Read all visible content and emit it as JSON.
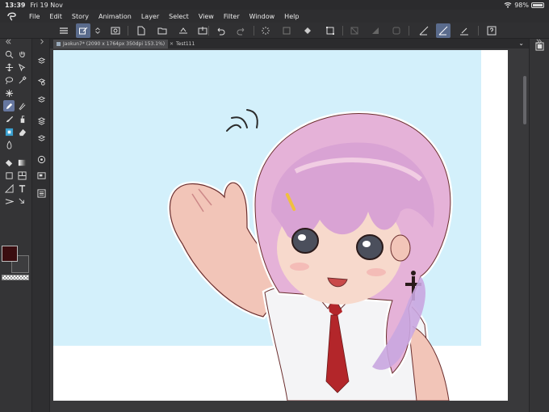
{
  "status": {
    "time": "13:39",
    "date": "Fri 19 Nov",
    "battery": "98%",
    "battery_level": 0.98
  },
  "menu": {
    "items": [
      "File",
      "Edit",
      "Story",
      "Animation",
      "Layer",
      "Select",
      "View",
      "Filter",
      "Window",
      "Help"
    ]
  },
  "tabs": [
    {
      "label": "Jaokun7* (2090 x 1764px 350dpi 153.1%)"
    },
    {
      "label": "Test111"
    }
  ],
  "colors": {
    "main_color": "#3a0d10",
    "accent": "#5a6b8c",
    "canvas_sky": "#d3f0fb"
  }
}
